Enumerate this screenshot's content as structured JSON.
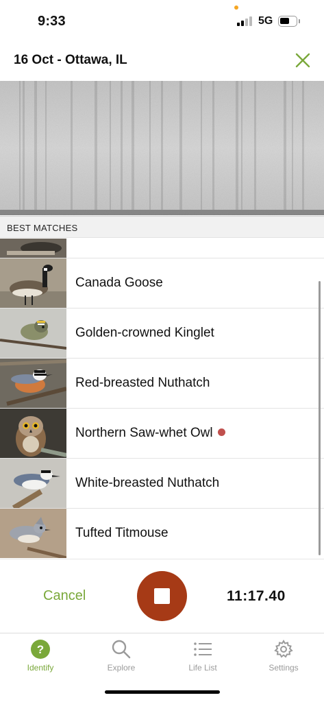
{
  "status": {
    "time": "9:33",
    "network": "5G",
    "signal_bars_active": 2,
    "signal_bars_total": 4,
    "battery_level": 0.6
  },
  "header": {
    "title": "16 Oct - Ottawa, IL",
    "close_icon": "close-x-icon"
  },
  "section": {
    "label": "BEST MATCHES"
  },
  "matches": [
    {
      "name": "",
      "photo": "partial-bird-photo",
      "recording_indicator": false
    },
    {
      "name": "Canada Goose",
      "photo": "canada-goose-photo",
      "recording_indicator": false
    },
    {
      "name": "Golden-crowned Kinglet",
      "photo": "golden-crowned-kinglet-photo",
      "recording_indicator": false
    },
    {
      "name": "Red-breasted Nuthatch",
      "photo": "red-breasted-nuthatch-photo",
      "recording_indicator": false
    },
    {
      "name": "Northern Saw-whet Owl",
      "photo": "northern-saw-whet-owl-photo",
      "recording_indicator": true
    },
    {
      "name": "White-breasted Nuthatch",
      "photo": "white-breasted-nuthatch-photo",
      "recording_indicator": false
    },
    {
      "name": "Tufted Titmouse",
      "photo": "tufted-titmouse-photo",
      "recording_indicator": false
    }
  ],
  "controls": {
    "cancel_label": "Cancel",
    "stop_icon": "stop-icon",
    "timer": "11:17.40"
  },
  "tabs": [
    {
      "label": "Identify",
      "icon": "question-circle-icon",
      "active": true
    },
    {
      "label": "Explore",
      "icon": "search-icon",
      "active": false
    },
    {
      "label": "Life List",
      "icon": "list-icon",
      "active": false
    },
    {
      "label": "Settings",
      "icon": "gear-icon",
      "active": false
    }
  ],
  "colors": {
    "accent_green": "#7aa83a",
    "stop_button": "#a63a16",
    "recording_dot": "#c0504d"
  }
}
